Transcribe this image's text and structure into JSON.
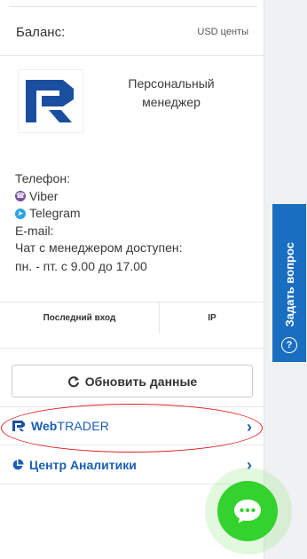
{
  "balance": {
    "label": "Баланс:",
    "currency": "USD центы"
  },
  "manager": {
    "title_line1": "Персональный",
    "title_line2": "менеджер"
  },
  "contacts": {
    "phone_label": "Телефон:",
    "viber_label": "Viber",
    "telegram_label": "Telegram",
    "email_label": "E-mail:",
    "chat_line": "Чат с менеджером доступен:",
    "schedule": "пн. - пт. с 9.00 до 17.00"
  },
  "login_table": {
    "col_last_login": "Последний вход",
    "col_ip": "IP"
  },
  "refresh_button": {
    "label": "Обновить данные"
  },
  "menu": {
    "webtrader": {
      "web": "Web",
      "trader": "TRADER"
    },
    "analytics": {
      "label": "Центр Аналитики"
    }
  },
  "ask_question": {
    "label": "Задать вопрос"
  },
  "colors": {
    "accent": "#1a5fb4",
    "tab_blue": "#1a6ec0",
    "chat_green": "#33d22c",
    "highlight_red": "#e02020"
  }
}
